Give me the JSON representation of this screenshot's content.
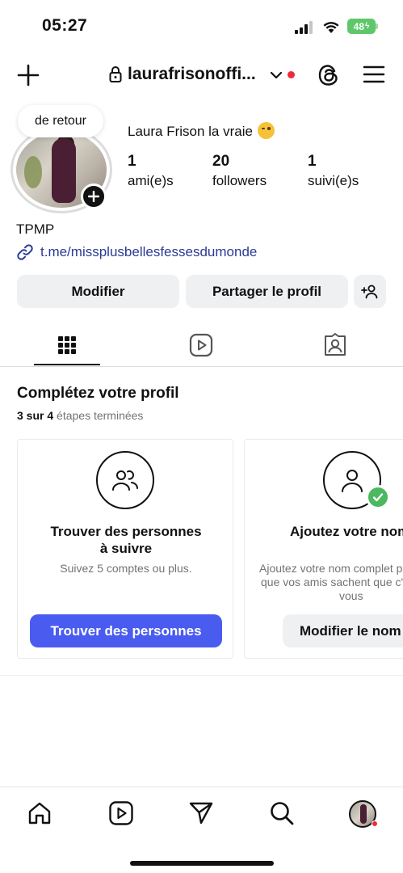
{
  "status_bar": {
    "time": "05:27",
    "battery": "48",
    "icons": [
      "signal-icon",
      "wifi-icon",
      "battery-icon"
    ]
  },
  "header": {
    "username": "laurafrisonoffi...",
    "icons": [
      "plus-icon",
      "lock-icon",
      "chevron-down-icon",
      "threads-icon",
      "menu-icon"
    ],
    "notification_dot_color": "#ee2a3b"
  },
  "profile": {
    "note": "de retour",
    "display_name": "Laura Frison la vraie",
    "stats": [
      {
        "count": "1",
        "label": "ami(e)s"
      },
      {
        "count": "20",
        "label": "followers"
      },
      {
        "count": "1",
        "label": "suivi(e)s"
      }
    ],
    "bio": "TPMP",
    "link": "t.me/missplusbellesfessesdumonde"
  },
  "actions": {
    "edit": "Modifier",
    "share": "Partager le profil",
    "add_person_icon": "add-person-icon"
  },
  "tabs": [
    {
      "name": "grid",
      "icon": "grid-icon",
      "active": true
    },
    {
      "name": "reels",
      "icon": "reels-icon",
      "active": false
    },
    {
      "name": "tagged",
      "icon": "tagged-icon",
      "active": false
    }
  ],
  "complete_profile": {
    "title": "Complétez votre profil",
    "progress_count": "3 sur 4",
    "progress_text": "étapes terminées",
    "cards": [
      {
        "icon": "people-icon",
        "title_line1": "Trouver des personnes",
        "title_line2": "à suivre",
        "desc_line1": "Suivez 5 comptes ou plus.",
        "button": "Trouver des personnes",
        "button_color": "#4a5cf0"
      },
      {
        "icon": "person-icon",
        "title_line1": "Ajoutez votre nom",
        "desc_line1": "Ajoutez votre nom complet pour",
        "desc_line2": "que vos amis sachent que c'est",
        "desc_line3": "vous",
        "button": "Modifier le nom",
        "completed": true
      }
    ]
  },
  "bottom_nav": {
    "items": [
      "home-icon",
      "reels-icon",
      "send-icon",
      "search-icon",
      "profile-avatar"
    ]
  },
  "colors": {
    "accent_blue": "#4a5cf0",
    "link_blue": "#2a3a96",
    "battery_green": "#5fc76a",
    "check_green": "#4cb85f",
    "button_gray": "#eff0f2"
  }
}
